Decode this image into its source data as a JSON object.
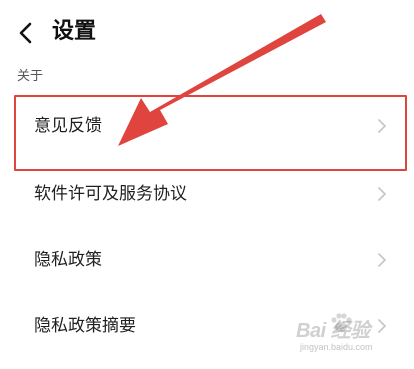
{
  "header": {
    "title": "设置",
    "back_icon": "chevron-left-icon"
  },
  "section": {
    "label": "关于"
  },
  "items": [
    {
      "label": "意见反馈",
      "icon": "chevron-right-icon"
    },
    {
      "label": "软件许可及服务协议",
      "icon": "chevron-right-icon"
    },
    {
      "label": "隐私政策",
      "icon": "chevron-right-icon"
    },
    {
      "label": "隐私政策摘要",
      "icon": "chevron-right-icon"
    }
  ],
  "annotation": {
    "highlight_color": "#e0443e",
    "arrow_color": "#e0443e"
  },
  "watermark": {
    "logo": "Bai 经验",
    "url": "jingyan.baidu.com"
  },
  "colors": {
    "background": "#ffffff",
    "text": "#1f1f1f",
    "chevron": "#c4c4c4"
  }
}
